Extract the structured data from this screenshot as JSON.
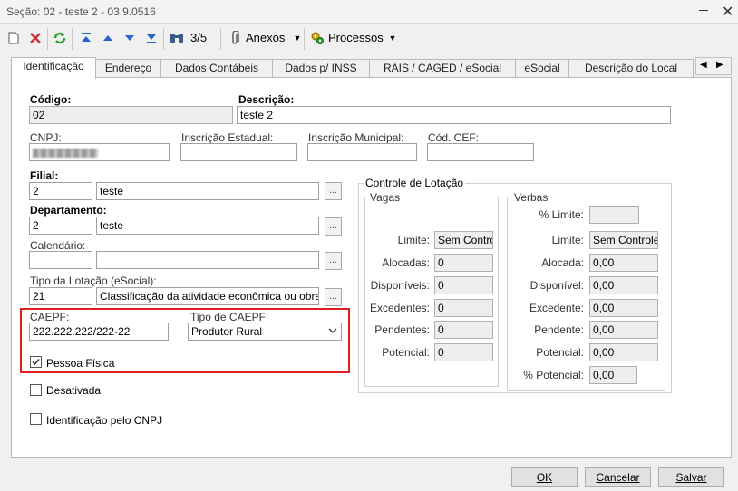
{
  "window": {
    "title": "Seção: 02 - teste 2 - 03.9.0516"
  },
  "toolbar": {
    "counter": "3/5",
    "anexos": "Anexos",
    "processos": "Processos"
  },
  "tabs": [
    {
      "label": "Identificação"
    },
    {
      "label": "Endereço"
    },
    {
      "label": "Dados Contábeis"
    },
    {
      "label": "Dados p/ INSS"
    },
    {
      "label": "RAIS / CAGED / eSocial"
    },
    {
      "label": "eSocial"
    },
    {
      "label": "Descrição do Local"
    }
  ],
  "form": {
    "codigo": {
      "label": "Código:",
      "value": "02"
    },
    "descricao": {
      "label": "Descrição:",
      "value": "teste 2"
    },
    "cnpj": {
      "label": "CNPJ:"
    },
    "insc_estadual": {
      "label": "Inscrição Estadual:",
      "value": ""
    },
    "insc_municipal": {
      "label": "Inscrição Municipal:",
      "value": ""
    },
    "cod_cef": {
      "label": "Cód. CEF:",
      "value": ""
    },
    "filial": {
      "label": "Filial:",
      "code": "2",
      "name": "teste"
    },
    "departamento": {
      "label": "Departamento:",
      "code": "2",
      "name": "teste"
    },
    "calendario": {
      "label": "Calendário:",
      "code": "",
      "name": ""
    },
    "tipo_lotacao": {
      "label": "Tipo da Lotação (eSocial):",
      "code": "21",
      "name": "Classificação da atividade econômica ou obra próp"
    },
    "caepf": {
      "label": "CAEPF:",
      "value": "222.222.222/222-22"
    },
    "tipo_caepf": {
      "label": "Tipo de CAEPF:",
      "value": "Produtor Rural"
    },
    "pessoa_fisica": {
      "label": "Pessoa Física",
      "checked": true
    },
    "desativada": {
      "label": "Desativada",
      "checked": false
    },
    "ident_cnpj": {
      "label": "Identificação pelo CNPJ",
      "checked": false
    },
    "lookup_button": "..."
  },
  "controle": {
    "title": "Controle de Lotação",
    "vagas": {
      "title": "Vagas",
      "limite": {
        "label": "Limite:",
        "value": "Sem Controle"
      },
      "alocadas": {
        "label": "Alocadas:",
        "value": "0"
      },
      "disponiveis": {
        "label": "Disponíveis:",
        "value": "0"
      },
      "excedentes": {
        "label": "Excedentes:",
        "value": "0"
      },
      "pendentes": {
        "label": "Pendentes:",
        "value": "0"
      },
      "potencial": {
        "label": "Potencial:",
        "value": "0"
      }
    },
    "verbas": {
      "title": "Verbas",
      "pct_limite": {
        "label": "% Limite:",
        "value": ""
      },
      "limite": {
        "label": "Limite:",
        "value": "Sem Controle"
      },
      "alocada": {
        "label": "Alocada:",
        "value": "0,00"
      },
      "disponivel": {
        "label": "Disponível:",
        "value": "0,00"
      },
      "excedente": {
        "label": "Excedente:",
        "value": "0,00"
      },
      "pendente": {
        "label": "Pendente:",
        "value": "0,00"
      },
      "potencial": {
        "label": "Potencial:",
        "value": "0,00"
      },
      "pct_potencial": {
        "label": "% Potencial:",
        "value": "0,00"
      }
    }
  },
  "footer": {
    "ok": "OK",
    "cancelar": "Cancelar",
    "salvar": "Salvar"
  },
  "colors": {
    "highlight": "#e02020",
    "arrow_blue": "#2a62c9",
    "refresh_green": "#2aa02a",
    "delete_red": "#d03030"
  }
}
